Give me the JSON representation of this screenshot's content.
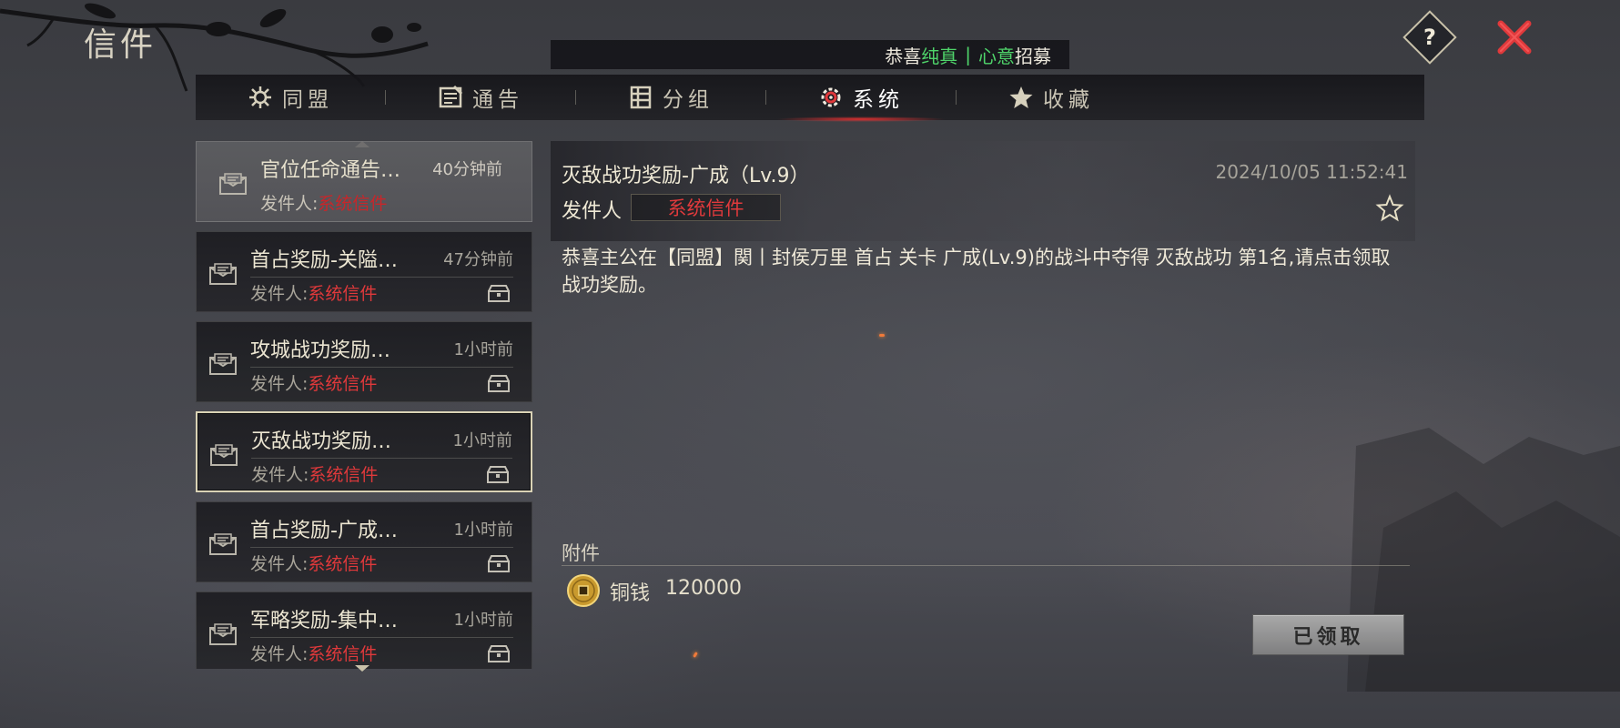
{
  "window": {
    "title": "信件"
  },
  "announcement": {
    "prefix": "恭喜",
    "name1": "纯真",
    "separator": "|",
    "name2": "心意",
    "suffix": "招募"
  },
  "tabs": [
    {
      "label": "同盟",
      "icon": "alliance-icon",
      "active": false
    },
    {
      "label": "通告",
      "icon": "announcement-icon",
      "active": false
    },
    {
      "label": "分组",
      "icon": "group-icon",
      "active": false
    },
    {
      "label": "系统",
      "icon": "gear-icon",
      "active": true
    },
    {
      "label": "收藏",
      "icon": "star-icon",
      "active": false
    }
  ],
  "mail_list": {
    "sender_prefix": "发件人:",
    "items": [
      {
        "title": "官位任命通告…",
        "time": "40分钟前",
        "sender": "系统信件",
        "read": true,
        "has_attachment": false
      },
      {
        "title": "首占奖励-关隘…",
        "time": "47分钟前",
        "sender": "系统信件",
        "read": false,
        "has_attachment": true
      },
      {
        "title": "攻城战功奖励…",
        "time": "1小时前",
        "sender": "系统信件",
        "read": false,
        "has_attachment": true
      },
      {
        "title": "灭敌战功奖励…",
        "time": "1小时前",
        "sender": "系统信件",
        "read": false,
        "has_attachment": true,
        "selected": true
      },
      {
        "title": "首占奖励-广成…",
        "time": "1小时前",
        "sender": "系统信件",
        "read": false,
        "has_attachment": true
      },
      {
        "title": "军略奖励-集中…",
        "time": "1小时前",
        "sender": "系统信件",
        "read": false,
        "has_attachment": true
      }
    ]
  },
  "detail": {
    "title": "灭敌战功奖励-广成（Lv.9）",
    "date": "2024/10/05 11:52:41",
    "sender_label": "发件人",
    "sender": "系统信件",
    "body": "恭喜主公在【同盟】関丨封侯万里 首占 关卡 广成(Lv.9)的战斗中夺得 灭敌战功 第1名,请点击领取战功奖励。",
    "attachment_label": "附件",
    "attachment": {
      "name": "铜钱",
      "quantity": "120000",
      "icon": "copper-coin-icon"
    },
    "claim_button": "已领取"
  },
  "colors": {
    "accent_red": "#e0393b",
    "highlight_green": "#4fd46a",
    "close_red": "#e0393b"
  }
}
